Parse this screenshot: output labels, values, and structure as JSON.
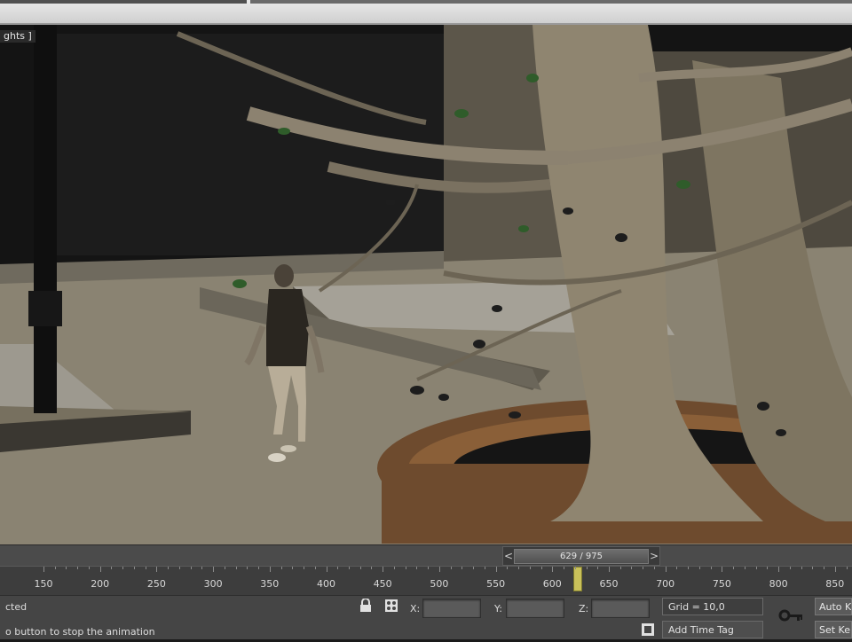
{
  "viewport": {
    "label": "ghts ]"
  },
  "time_slider": {
    "value": "629 / 975",
    "prev_arrow": "<",
    "next_arrow": ">",
    "current_frame": 629,
    "total_frames": 975
  },
  "ruler": {
    "ticks": [
      "150",
      "200",
      "250",
      "300",
      "350",
      "400",
      "450",
      "500",
      "550",
      "600",
      "650",
      "700",
      "750",
      "800",
      "850"
    ]
  },
  "status": {
    "selection_text": "cted",
    "prompt_text": "o button to stop the animation",
    "axis_x": "X:",
    "axis_y": "Y:",
    "axis_z": "Z:",
    "x_value": "",
    "y_value": "",
    "z_value": "",
    "grid_text": "Grid = 10,0",
    "add_time_tag": "Add Time Tag",
    "auto_key": "Auto Ke",
    "set_key": "Set Ke"
  },
  "icons": {
    "lock": "lock-icon",
    "absolute_mode": "transform-mode-icon",
    "key": "key-icon",
    "filter": "key-filter-icon"
  },
  "colors": {
    "ground": "#8a8372",
    "playhead": "#c9c15a"
  }
}
